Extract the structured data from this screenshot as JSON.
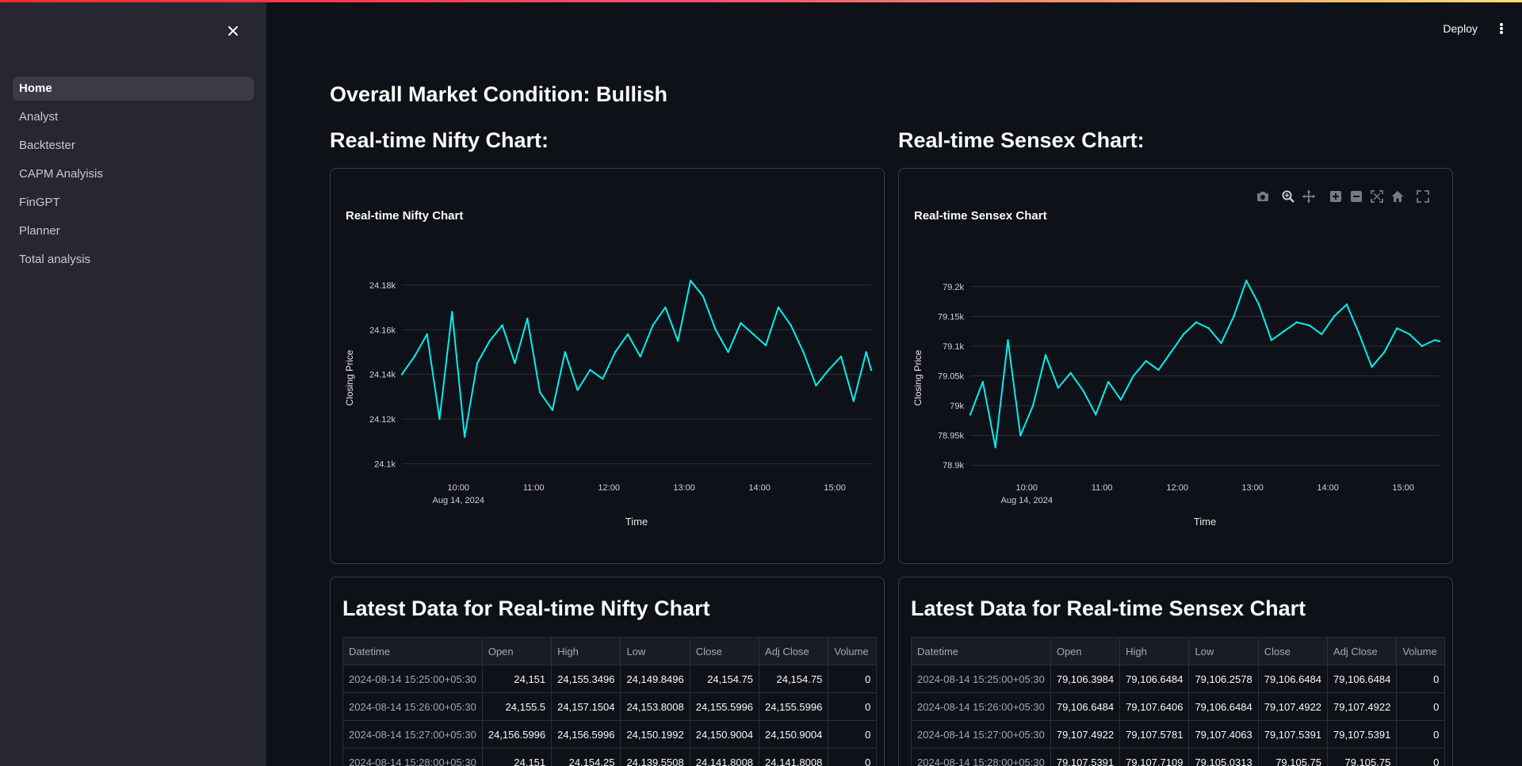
{
  "sidebar": {
    "items": [
      {
        "label": "Home",
        "active": true
      },
      {
        "label": "Analyst"
      },
      {
        "label": "Backtester"
      },
      {
        "label": "CAPM Analyisis"
      },
      {
        "label": "FinGPT"
      },
      {
        "label": "Planner"
      },
      {
        "label": "Total analysis"
      }
    ]
  },
  "header": {
    "deploy_label": "Deploy"
  },
  "main": {
    "market_condition": "Overall Market Condition: Bullish",
    "nifty_heading": "Real-time Nifty Chart:",
    "sensex_heading": "Real-time Sensex Chart:"
  },
  "chart_data": [
    {
      "type": "line",
      "title": "Real-time Nifty Chart",
      "xlabel": "Time",
      "ylabel": "Closing Price",
      "x_ticks": [
        "10:00",
        "11:00",
        "12:00",
        "13:00",
        "14:00",
        "15:00"
      ],
      "x_date_label": "Aug 14, 2024",
      "y_ticks": [
        "24.1k",
        "24.12k",
        "24.14k",
        "24.16k",
        "24.18k"
      ],
      "ylim": [
        24098,
        24186
      ],
      "xlim": [
        "09:15",
        "15:29"
      ],
      "color": "#00f0f0",
      "grid": true,
      "x": [
        "09:15",
        "09:25",
        "09:35",
        "09:45",
        "09:55",
        "10:05",
        "10:15",
        "10:25",
        "10:35",
        "10:45",
        "10:55",
        "11:05",
        "11:15",
        "11:25",
        "11:35",
        "11:45",
        "11:55",
        "12:05",
        "12:15",
        "12:25",
        "12:35",
        "12:45",
        "12:55",
        "13:05",
        "13:15",
        "13:25",
        "13:35",
        "13:45",
        "13:55",
        "14:05",
        "14:15",
        "14:25",
        "14:35",
        "14:45",
        "14:55",
        "15:05",
        "15:15",
        "15:25",
        "15:29"
      ],
      "values": [
        24140,
        24148,
        24158,
        24120,
        24168,
        24112,
        24145,
        24155,
        24162,
        24145,
        24165,
        24132,
        24124,
        24150,
        24133,
        24142,
        24138,
        24150,
        24158,
        24148,
        24162,
        24170,
        24155,
        24182,
        24175,
        24160,
        24150,
        24163,
        24158,
        24153,
        24170,
        24162,
        24150,
        24135,
        24142,
        24148,
        24128,
        24150,
        24142
      ]
    },
    {
      "type": "line",
      "title": "Real-time Sensex Chart",
      "xlabel": "Time",
      "ylabel": "Closing Price",
      "x_ticks": [
        "10:00",
        "11:00",
        "12:00",
        "13:00",
        "14:00",
        "15:00"
      ],
      "x_date_label": "Aug 14, 2024",
      "y_ticks": [
        "78.9k",
        "78.95k",
        "79k",
        "79.05k",
        "79.1k",
        "79.15k",
        "79.2k"
      ],
      "ylim": [
        78895,
        79225
      ],
      "xlim": [
        "09:15",
        "15:29"
      ],
      "color": "#00f0f0",
      "grid": true,
      "x": [
        "09:15",
        "09:25",
        "09:35",
        "09:45",
        "09:55",
        "10:05",
        "10:15",
        "10:25",
        "10:35",
        "10:45",
        "10:55",
        "11:05",
        "11:15",
        "11:25",
        "11:35",
        "11:45",
        "11:55",
        "12:05",
        "12:15",
        "12:25",
        "12:35",
        "12:45",
        "12:55",
        "13:05",
        "13:15",
        "13:25",
        "13:35",
        "13:45",
        "13:55",
        "14:05",
        "14:15",
        "14:25",
        "14:35",
        "14:45",
        "14:55",
        "15:05",
        "15:15",
        "15:25",
        "15:29"
      ],
      "values": [
        78985,
        79040,
        78930,
        79110,
        78950,
        79000,
        79085,
        79030,
        79055,
        79025,
        78985,
        79040,
        79010,
        79050,
        79075,
        79060,
        79090,
        79120,
        79140,
        79130,
        79105,
        79150,
        79210,
        79170,
        79110,
        79125,
        79140,
        79135,
        79120,
        79150,
        79170,
        79120,
        79065,
        79090,
        79130,
        79120,
        79100,
        79110,
        79108
      ]
    }
  ],
  "tables": [
    {
      "title": "Latest Data for Real-time Nifty Chart",
      "columns": [
        "Datetime",
        "Open",
        "High",
        "Low",
        "Close",
        "Adj Close",
        "Volume"
      ],
      "rows": [
        [
          "2024-08-14 15:25:00+05:30",
          "24,151",
          "24,155.3496",
          "24,149.8496",
          "24,154.75",
          "24,154.75",
          "0"
        ],
        [
          "2024-08-14 15:26:00+05:30",
          "24,155.5",
          "24,157.1504",
          "24,153.8008",
          "24,155.5996",
          "24,155.5996",
          "0"
        ],
        [
          "2024-08-14 15:27:00+05:30",
          "24,156.5996",
          "24,156.5996",
          "24,150.1992",
          "24,150.9004",
          "24,150.9004",
          "0"
        ],
        [
          "2024-08-14 15:28:00+05:30",
          "24,151",
          "24,154.25",
          "24,139.5508",
          "24,141.8008",
          "24,141.8008",
          "0"
        ]
      ]
    },
    {
      "title": "Latest Data for Real-time Sensex Chart",
      "columns": [
        "Datetime",
        "Open",
        "High",
        "Low",
        "Close",
        "Adj Close",
        "Volume"
      ],
      "rows": [
        [
          "2024-08-14 15:25:00+05:30",
          "79,106.3984",
          "79,106.6484",
          "79,106.2578",
          "79,106.6484",
          "79,106.6484",
          "0"
        ],
        [
          "2024-08-14 15:26:00+05:30",
          "79,106.6484",
          "79,107.6406",
          "79,106.6484",
          "79,107.4922",
          "79,107.4922",
          "0"
        ],
        [
          "2024-08-14 15:27:00+05:30",
          "79,107.4922",
          "79,107.5781",
          "79,107.4063",
          "79,107.5391",
          "79,107.5391",
          "0"
        ],
        [
          "2024-08-14 15:28:00+05:30",
          "79,107.5391",
          "79,107.7109",
          "79,105.0313",
          "79,105.75",
          "79,105.75",
          "0"
        ]
      ]
    }
  ],
  "icons": {
    "close": "close-icon",
    "menu": "kebab-menu-icon",
    "modebar": [
      "camera-icon",
      "zoom-icon",
      "pan-icon",
      "zoom-in-icon",
      "zoom-out-icon",
      "autoscale-icon",
      "reset-axes-icon",
      "fullscreen-icon"
    ]
  }
}
